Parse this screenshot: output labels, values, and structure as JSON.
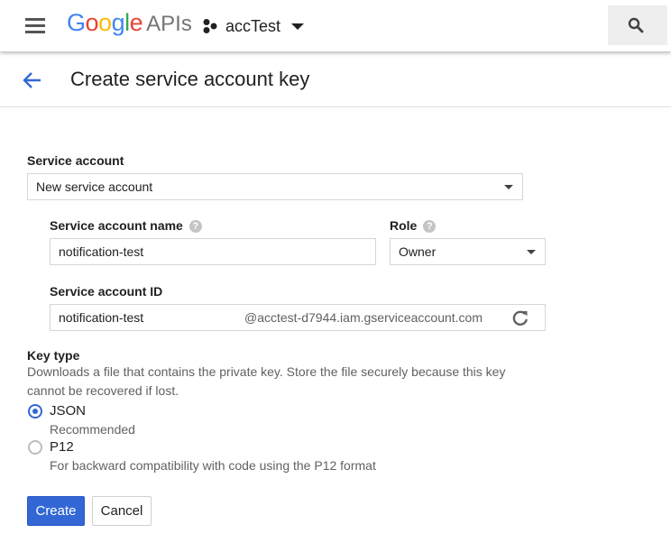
{
  "topbar": {
    "logo_google": "Google",
    "logo_apis": "APIs",
    "project_name": "accTest",
    "icons": {
      "menu": "hamburger-menu-icon",
      "project": "project-dots-icon",
      "dropdown": "chevron-down-icon",
      "search": "search-icon"
    }
  },
  "header": {
    "title": "Create service account key",
    "back_icon": "arrow-back-icon"
  },
  "form": {
    "service_account_label": "Service account",
    "service_account_value": "New service account",
    "name_label": "Service account name",
    "name_value": "notification-test",
    "role_label": "Role",
    "role_value": "Owner",
    "id_label": "Service account ID",
    "id_value": "notification-test",
    "id_suffix": "@acctest-d7944.iam.gserviceaccount.com",
    "help_icon": "help-icon",
    "refresh_icon": "refresh-icon",
    "key_type_label": "Key type",
    "key_type_desc_line1": "Downloads a file that contains the private key. Store the file securely because this key",
    "key_type_desc_line2": "cannot be recovered if lost.",
    "options": [
      {
        "label": "JSON",
        "desc": "Recommended",
        "selected": true
      },
      {
        "label": "P12",
        "desc": "For backward compatibility with code using the P12 format",
        "selected": false
      }
    ]
  },
  "actions": {
    "create_label": "Create",
    "cancel_label": "Cancel"
  },
  "colors": {
    "accent": "#3367d6",
    "google_blue": "#4285f4",
    "google_red": "#ea4335",
    "google_yellow": "#fbbc05",
    "google_green": "#34a853"
  }
}
